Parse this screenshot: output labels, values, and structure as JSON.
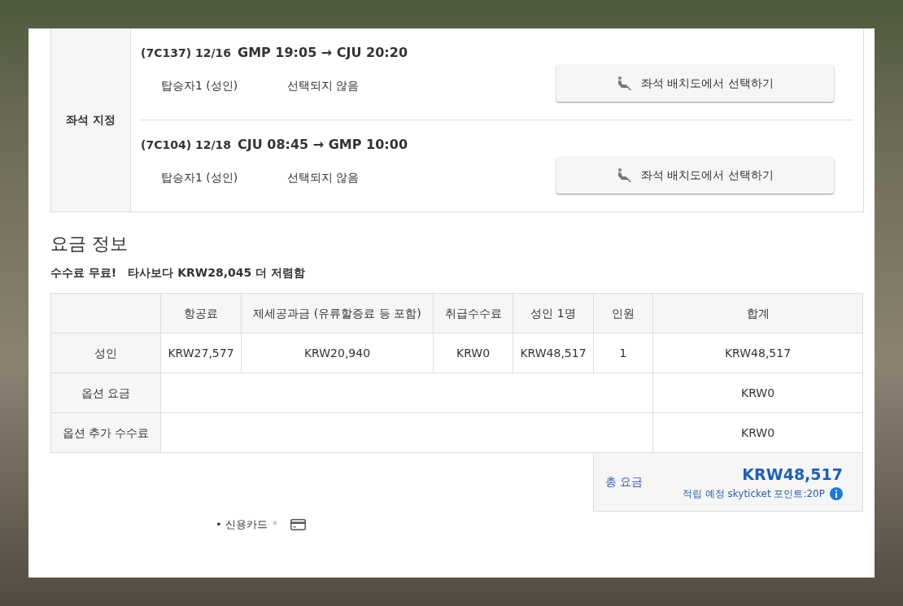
{
  "seat_assignment": {
    "label": "좌석 지정",
    "flights": [
      {
        "code_date": "(7C137) 12/16",
        "route": "GMP 19:05 → CJU 20:20",
        "passengers": [
          {
            "name": "탑승자1 (성인)",
            "seat": "선택되지 않음"
          }
        ],
        "button": "좌석 배치도에서 선택하기"
      },
      {
        "code_date": "(7C104) 12/18",
        "route": "CJU 08:45 → GMP 10:00",
        "passengers": [
          {
            "name": "탑승자1 (성인)",
            "seat": "선택되지 않음"
          }
        ],
        "button": "좌석 배치도에서 선택하기"
      }
    ]
  },
  "fare": {
    "title": "요금 정보",
    "note": [
      "수수료 무료!",
      "타사보다 KRW28,045 더 저렴함"
    ],
    "columns": [
      "항공료",
      "제세공과금 (유류할증료 등 포함)",
      "취급수수료",
      "성인 1명",
      "인원",
      "합계"
    ],
    "rows": [
      {
        "kind": "detail",
        "label": "성인",
        "cells": [
          "KRW27,577",
          "KRW20,940",
          "KRW0",
          "KRW48,517",
          "1",
          "KRW48,517"
        ]
      },
      {
        "kind": "summary",
        "label": "옵션 요금",
        "cells": [
          "KRW0"
        ]
      },
      {
        "kind": "summary",
        "label": "옵션 추가 수수료",
        "cells": [
          "KRW0"
        ]
      }
    ],
    "total": {
      "label": "총 요금",
      "amount": "KRW48,517",
      "points": "적립 예정 skyticket 포인트:20P"
    }
  },
  "payment": {
    "label": "• 신용카드",
    "required_mark": "*"
  }
}
